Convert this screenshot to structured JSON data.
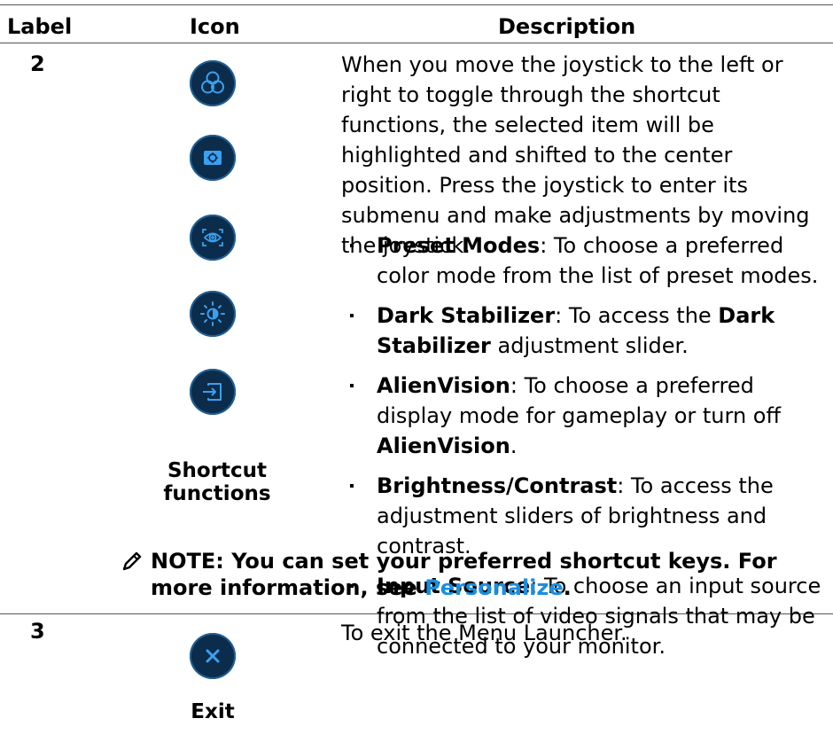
{
  "headers": {
    "label": "Label",
    "icon": "Icon",
    "description": "Description"
  },
  "rows": [
    {
      "label": "2",
      "icons": [
        "preset-modes-icon",
        "dark-stabilizer-icon",
        "alienvision-icon",
        "brightness-contrast-icon",
        "input-source-icon"
      ],
      "caption": "Shortcut functions",
      "intro": "When you move the joystick to the left or right to toggle through the shortcut functions, the selected item will be highlighted and shifted to the center position. Press the joystick to enter its submenu and make adjustments by moving the joystick.",
      "bullets": [
        {
          "term": "Preset Modes",
          "text": ": To choose a preferred color mode from the list of preset modes."
        },
        {
          "term": "Dark Stabilizer",
          "text": ": To access the ",
          "term2": "Dark Stabilizer",
          "text2": " adjustment slider."
        },
        {
          "term": "AlienVision",
          "text": ": To choose a preferred display mode for gameplay or turn off ",
          "term2": "AlienVision",
          "text2": "."
        },
        {
          "term": "Brightness",
          "sep": "/",
          "term2": "Contrast",
          "text": ": To access the adjustment sliders of brightness and contrast."
        },
        {
          "term": "Input Source",
          "text": ": To choose an input source from the list of video signals that may be connected to your monitor."
        }
      ]
    },
    {
      "label": "3",
      "icons": [
        "exit-icon"
      ],
      "caption": "Exit",
      "intro": "To exit the Menu Launcher."
    }
  ],
  "note": {
    "text": "NOTE: You can set your preferred shortcut keys. For more information, see ",
    "link": "Personalize",
    "end": "."
  },
  "colors": {
    "icon_bg": "#0b2c4a",
    "icon_fg": "#3aa0f0",
    "link": "#1a8fe0"
  }
}
